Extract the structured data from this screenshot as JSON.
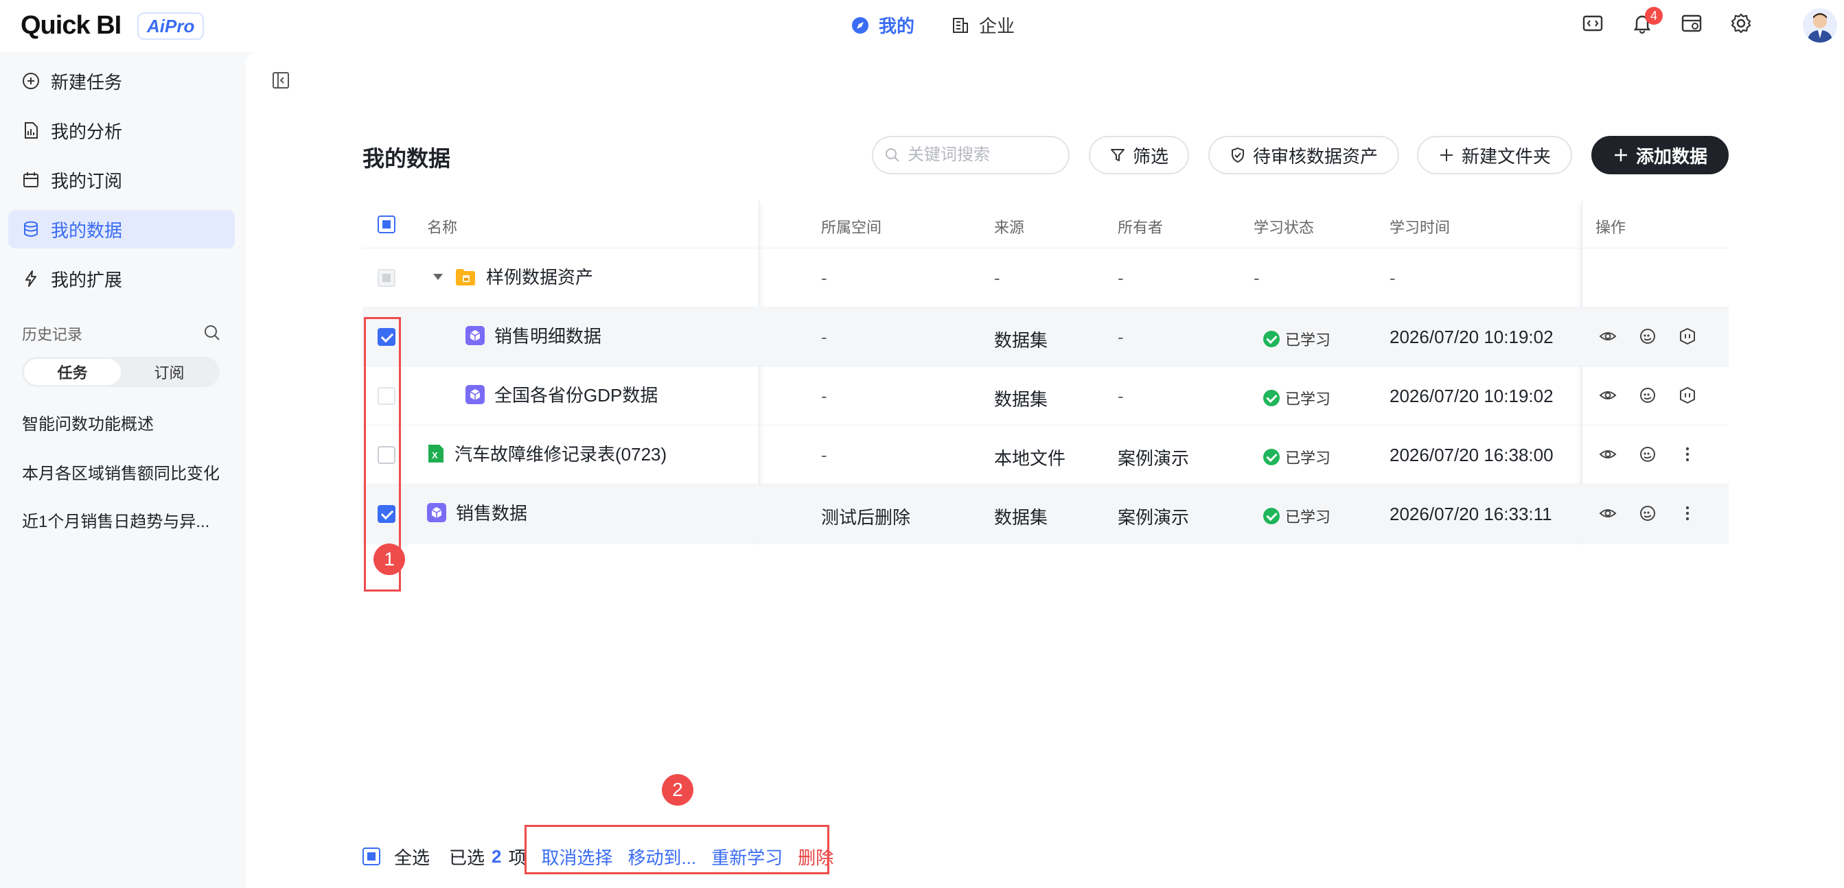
{
  "header": {
    "logo": "Quick BI",
    "badge_text": "AiPro",
    "nav": [
      {
        "label": "我的",
        "active": true
      },
      {
        "label": "企业",
        "active": false
      }
    ],
    "notification_count": "4"
  },
  "sidebar": {
    "items": [
      {
        "label": "新建任务",
        "icon": "plus-circle-icon"
      },
      {
        "label": "我的分析",
        "icon": "document-icon"
      },
      {
        "label": "我的订阅",
        "icon": "calendar-icon"
      },
      {
        "label": "我的数据",
        "icon": "database-icon",
        "active": true
      },
      {
        "label": "我的扩展",
        "icon": "lightning-icon"
      }
    ],
    "history_title": "历史记录",
    "segments": [
      "任务",
      "订阅"
    ],
    "history": [
      "智能问数功能概述",
      "本月各区域销售额同比变化",
      "近1个月销售日趋势与异..."
    ]
  },
  "main": {
    "title": "我的数据",
    "search_placeholder": "关键词搜索",
    "filter_label": "筛选",
    "pending_label": "待审核数据资产",
    "new_folder_label": "新建文件夹",
    "add_data_label": "添加数据",
    "columns": [
      "名称",
      "所属空间",
      "来源",
      "所有者",
      "学习状态",
      "学习时间",
      "操作"
    ],
    "rows": [
      {
        "name": "样例数据资产",
        "space": "-",
        "source": "-",
        "owner": "-",
        "status": "-",
        "time": "-"
      },
      {
        "name": "销售明细数据",
        "space": "-",
        "source": "数据集",
        "owner": "-",
        "status": "已学习",
        "time": "2026/07/20 10:19:02"
      },
      {
        "name": "全国各省份GDP数据",
        "space": "-",
        "source": "数据集",
        "owner": "-",
        "status": "已学习",
        "time": "2026/07/20 10:19:02"
      },
      {
        "name": "汽车故障维修记录表(0723)",
        "space": "-",
        "source": "本地文件",
        "owner": "案例演示",
        "status": "已学习",
        "time": "2026/07/20 16:38:00"
      },
      {
        "name": "销售数据",
        "space": "测试后删除",
        "source": "数据集",
        "owner": "案例演示",
        "status": "已学习",
        "time": "2026/07/20 16:33:11"
      }
    ]
  },
  "footer": {
    "select_all": "全选",
    "selected_prefix": "已选",
    "selected_count": "2",
    "selected_suffix": "项",
    "cancel": "取消选择",
    "move": "移动到...",
    "relearn": "重新学习",
    "delete": "删除"
  },
  "markers": [
    "1",
    "2"
  ],
  "colors": {
    "accent": "#3a6cf4",
    "highlight": "#ef4b4b",
    "success": "#1fb55a"
  }
}
